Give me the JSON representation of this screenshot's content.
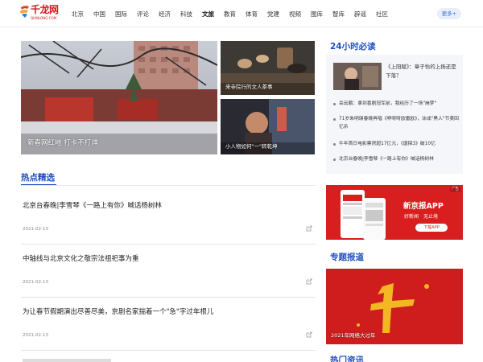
{
  "logo": {
    "name": "千龙网",
    "sub": "QIANLONG.COM"
  },
  "nav": {
    "items": [
      "北京",
      "中国",
      "国际",
      "评论",
      "经济",
      "科技",
      "文旅",
      "教育",
      "体育",
      "党建",
      "视频",
      "图库",
      "智库",
      "辟谣",
      "社区"
    ],
    "active": "文旅",
    "more": "更多+"
  },
  "hero": {
    "main_caption": "新春网红地 打卡不打烊",
    "top_right_caption": "来寺院行的文人茶事",
    "bottom_right_caption": "小人物如何\"一\"转乾坤"
  },
  "hot_picks": {
    "title": "热点精选",
    "items": [
      {
        "title": "北京台春晚|李雪琴《一路上有你》喊话杨树林",
        "date": "2021-02-13"
      },
      {
        "title": "中轴线与北京文化之敬宗法祖祀事为重",
        "date": "2021-02-13"
      },
      {
        "title": "为让春节假期演出尽善尽美，京剧名家揣着一个\"急\"字过年根儿",
        "date": "2021-02-13"
      }
    ]
  },
  "sidebar": {
    "must_read_title": "24小时必读",
    "feature": "《上阳赋》：章子怡的上扬还是下落？",
    "list": [
      "岳云鹏：拿到喜剧冠军前，我经历了一场\"崩梦\"",
      "71岁朱明瑛春晚再唱《咿呀呀欧雷欧》，泳成\"黑人\"节美回忆杀",
      "牛年首日电影票房超17亿元，《唐探3》破10亿",
      "北京台春晚|李雪琴《一路上有你》喊话杨树林"
    ],
    "ad": {
      "badge": "广告",
      "title": "新京报APP",
      "slogan": "好新闻　无止境",
      "button": "下载APP"
    },
    "special_title": "专题报道",
    "special_caption": "2021年网络大过年",
    "hot_news_title": "热门资讯"
  }
}
